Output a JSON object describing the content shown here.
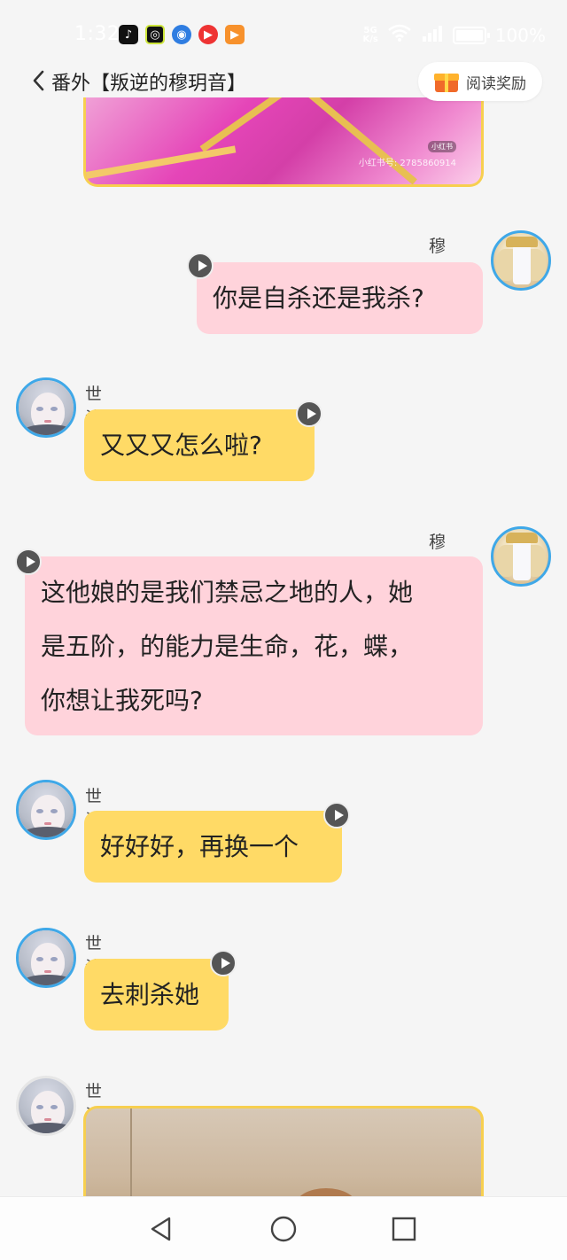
{
  "status_bar": {
    "time": "1:32",
    "network_top": "5G",
    "network_bottom": "K/s",
    "battery": "100%"
  },
  "header": {
    "title": "番外【叛逆的穆玥音】",
    "reward_label": "阅读奖励"
  },
  "top_image": {
    "tag": "小红书",
    "watermark": "小红书号: 2785860914"
  },
  "messages": [
    {
      "sender": "穆玥音",
      "side": "right",
      "text": "你是自杀还是我杀?"
    },
    {
      "sender": "世汐",
      "side": "left",
      "text": "又又又怎么啦?"
    },
    {
      "sender": "穆玥音",
      "side": "right",
      "lines": [
        "这他娘的是我们禁忌之地的人，她",
        "是五阶，的能力是生命，花，蝶，",
        "你想让我死吗?"
      ]
    },
    {
      "sender": "世汐",
      "side": "left",
      "text": "好好好，再换一个"
    },
    {
      "sender": "世汐",
      "side": "left",
      "text": "去刺杀她"
    },
    {
      "sender": "世汐",
      "side": "left",
      "type": "image"
    }
  ],
  "colors": {
    "pink_bubble": "#ffd3db",
    "yellow_bubble": "#ffda66",
    "avatar_ring": "#3fa8e8",
    "image_border": "#f7cf4f"
  },
  "icons": {
    "back": "chevron-left-icon",
    "reward": "gift-icon",
    "voice": "play-icon",
    "nav_back": "triangle-back-icon",
    "nav_home": "circle-home-icon",
    "nav_recent": "square-recent-icon"
  }
}
